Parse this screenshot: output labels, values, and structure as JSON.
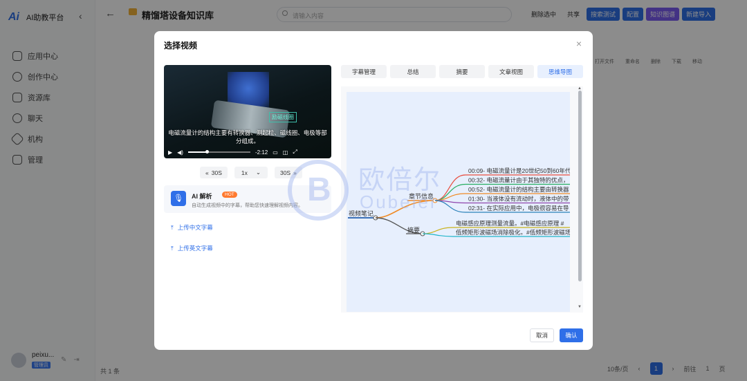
{
  "app": {
    "logo": "Ai",
    "name": "AI助教平台"
  },
  "sidebar": {
    "items": [
      {
        "label": "应用中心",
        "icon": "cube-icon"
      },
      {
        "label": "创作中心",
        "icon": "gear-icon"
      },
      {
        "label": "资源库",
        "icon": "document-icon"
      },
      {
        "label": "聊天",
        "icon": "chat-icon"
      },
      {
        "label": "机构",
        "icon": "org-icon"
      },
      {
        "label": "管理",
        "icon": "manage-icon"
      }
    ],
    "user": {
      "name": "peixu...",
      "tag": "管理员"
    }
  },
  "header": {
    "title": "精馏塔设备知识库",
    "search_placeholder": "请输入内容",
    "actions": [
      "删除选中",
      "共享",
      "搜索测试",
      "配置",
      "知识图谱",
      "新建导入"
    ]
  },
  "toolbar": [
    "打开文件",
    "重命名",
    "删除",
    "下载",
    "移动"
  ],
  "footer": {
    "count": "共 1 条",
    "page_size": "10条/页",
    "page": "1",
    "goto": "前往",
    "goto_value": "1",
    "goto_suffix": "页"
  },
  "modal": {
    "title": "选择视频",
    "video": {
      "caption": "电磁流量计的结构主要有转换器、测起粒、磁线圈、电极等部分组成。",
      "hud_label": "励磁线圈",
      "time": "-2:12",
      "progress": 0.3
    },
    "video_buttons": {
      "back": "30S",
      "speed": "1x",
      "forward": "30S"
    },
    "ai": {
      "title": "AI 解析",
      "hot": "HOT",
      "desc": "自动生成视频中的字幕，帮助您快速理解视频内容。"
    },
    "uploads": [
      "上传中文字幕",
      "上传英文字幕"
    ],
    "tabs": [
      {
        "label": "字幕管理",
        "active": false
      },
      {
        "label": "总结",
        "active": false
      },
      {
        "label": "摘要",
        "active": false
      },
      {
        "label": "文章视图",
        "active": false
      },
      {
        "label": "思维导图",
        "active": true
      }
    ],
    "mindmap": {
      "root": "视频笔记",
      "branches": [
        {
          "label": "章节信息",
          "color": "#f08a24",
          "children": [
            {
              "text": "00:09- 电磁流量计是20世纪50到60年代",
              "color": "#e84c3d"
            },
            {
              "text": "00:32- 电磁流量计由于其独特的优点，",
              "color": "#27ae60"
            },
            {
              "text": "00:52- 电磁流量计的结构主要由转换器",
              "color": "#f08a24"
            },
            {
              "text": "01:30- 当液体没有流动时，液体中的带",
              "color": "#8e44ad"
            },
            {
              "text": "02:31- 在实际应用中，电极很容易在导",
              "color": "#2980b9"
            }
          ]
        },
        {
          "label": "摘要",
          "color": "#555555",
          "children": [
            {
              "text": "电磁感应原理测量流量。#电磁感应原理 #",
              "color": "#c9b21d"
            },
            {
              "text": "低频矩形波磁场消除极化。#低频矩形波磁场",
              "color": "#1fb5c9"
            }
          ]
        }
      ]
    },
    "buttons": {
      "cancel": "取消",
      "ok": "确认"
    }
  },
  "watermark": {
    "cn": "欧倍尔",
    "en": "Oubeier"
  },
  "colors": {
    "primary": "#2f6fe8",
    "purple": "#7b5cf0",
    "hot": "#ff7a2f"
  }
}
